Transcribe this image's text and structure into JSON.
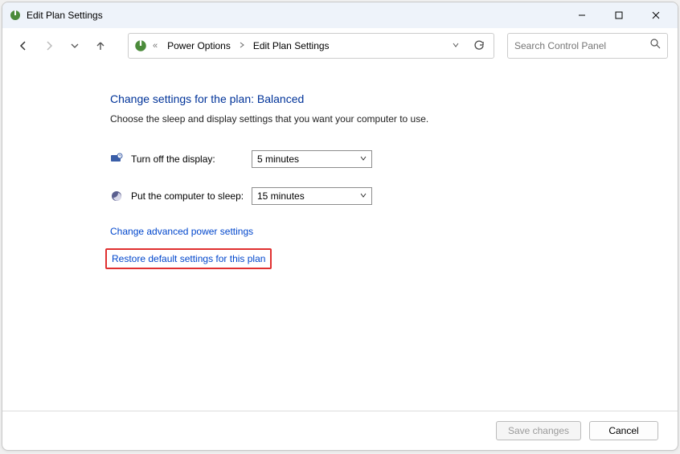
{
  "window": {
    "title": "Edit Plan Settings"
  },
  "breadcrumb": {
    "item1": "Power Options",
    "item2": "Edit Plan Settings"
  },
  "search": {
    "placeholder": "Search Control Panel"
  },
  "page": {
    "heading": "Change settings for the plan: Balanced",
    "subtext": "Choose the sleep and display settings that you want your computer to use."
  },
  "settings": {
    "display_label": "Turn off the display:",
    "display_value": "5 minutes",
    "sleep_label": "Put the computer to sleep:",
    "sleep_value": "15 minutes"
  },
  "links": {
    "advanced": "Change advanced power settings",
    "restore": "Restore default settings for this plan"
  },
  "buttons": {
    "save": "Save changes",
    "cancel": "Cancel"
  }
}
